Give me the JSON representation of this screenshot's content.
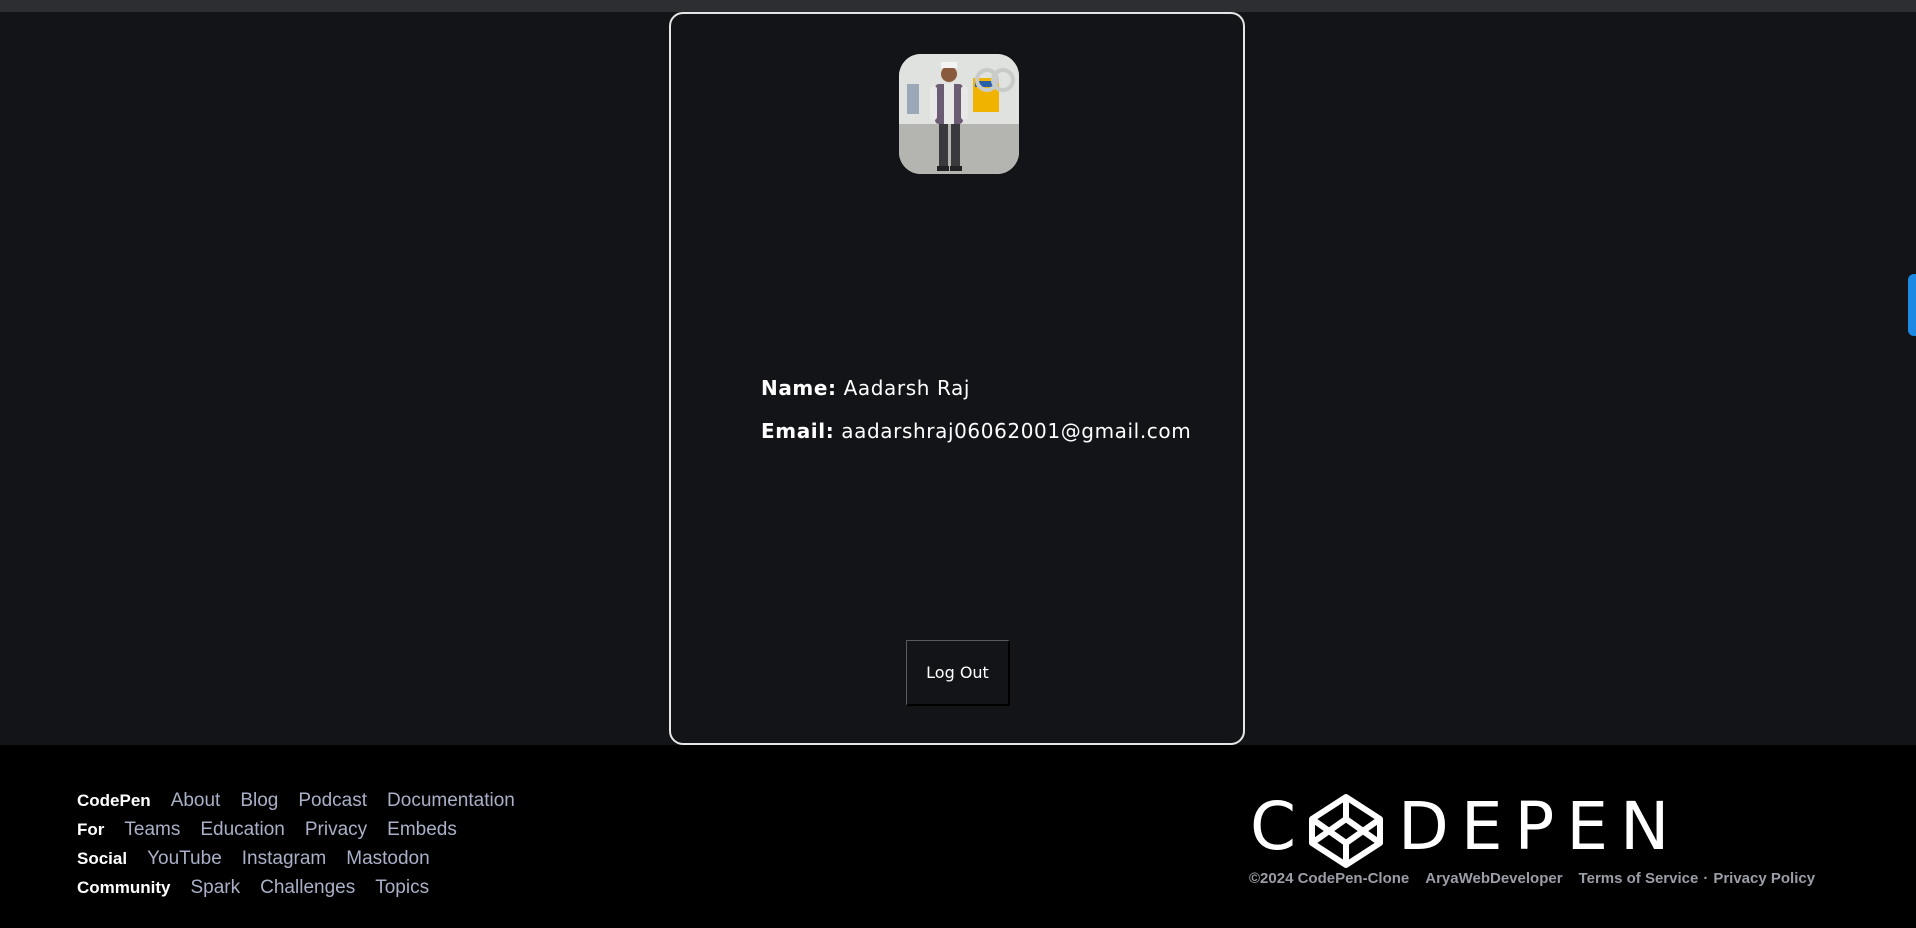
{
  "profile": {
    "name_label": "Name:",
    "name_value": "Aadarsh Raj",
    "email_label": "Email:",
    "email_value": "aadarshraj06062001@gmail.com",
    "logout_label": "Log Out"
  },
  "footer": {
    "rows": [
      {
        "heading": "CodePen",
        "links": [
          "About",
          "Blog",
          "Podcast",
          "Documentation"
        ]
      },
      {
        "heading": "For",
        "links": [
          "Teams",
          "Education",
          "Privacy",
          "Embeds"
        ]
      },
      {
        "heading": "Social",
        "links": [
          "YouTube",
          "Instagram",
          "Mastodon"
        ]
      },
      {
        "heading": "Community",
        "links": [
          "Spark",
          "Challenges",
          "Topics"
        ]
      }
    ],
    "brand": {
      "c": "C",
      "rest": "DEPEN",
      "logo_icon": "codepen-cube-icon"
    },
    "copyright": "©2024 CodePen-Clone",
    "author": "AryaWebDeveloper",
    "terms": "Terms of Service",
    "separator": "·",
    "privacy_policy": "Privacy Policy"
  },
  "colors": {
    "background": "#131417",
    "footer_bg": "#000000",
    "link": "#a9b0c7",
    "accent_tab": "#1e88e5"
  }
}
